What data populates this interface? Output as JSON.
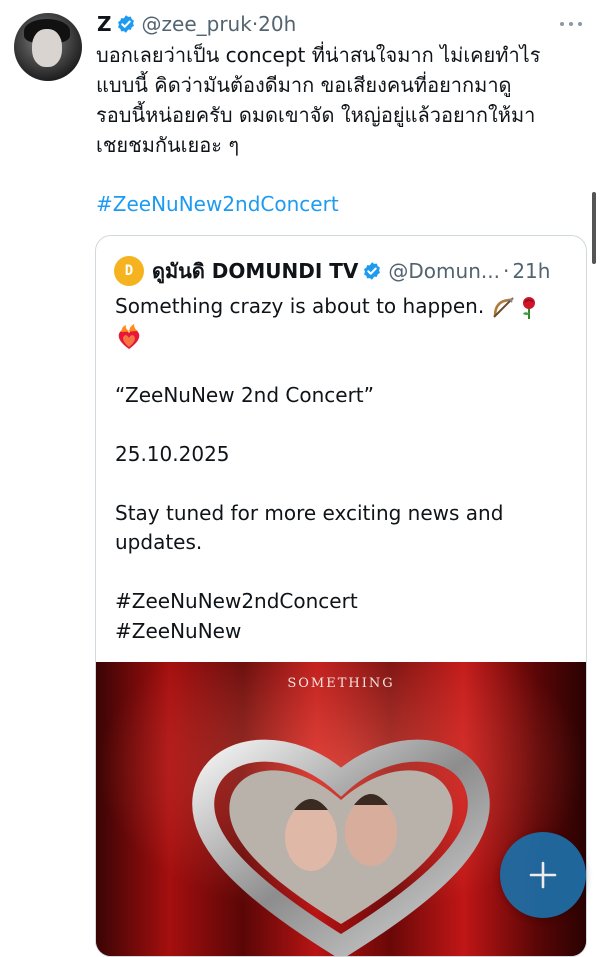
{
  "author": {
    "name": "Z",
    "handle": "@zee_pruk",
    "separator": "·",
    "time": "20h"
  },
  "tweet": {
    "text": "บอกเลยว่าเป็น concept ที่น่าสนใจมาก ไม่เคยทำไร\nแบบนี้ คิดว่ามันต้องดีมาก ขอเสียงคนที่อยากมาดู\nรอบนี้หน่อยครับ ดมดเขาจัด ใหญ่อยู่แล้วอยากให้มา\nเชยชมกันเยอะ ๆ",
    "hashtag": "#ZeeNuNew2ndConcert"
  },
  "quoted": {
    "avatar_text": "D",
    "name": "ดูมันดิ DOMUNDI TV",
    "handle": "@Domun...",
    "separator": "·",
    "time": "21h",
    "line1": "Something crazy is about to happen.",
    "line2": "“ZeeNuNew 2nd Concert”",
    "line3": "25.10.2025",
    "line4": "Stay tuned for more exciting news and\nupdates.",
    "line5": "#ZeeNuNew2ndConcert\n#ZeeNuNew",
    "media_text": "SOMETHING"
  },
  "icons": [
    "verified-badge-icon",
    "more-options-icon",
    "bow-arrow-emoji",
    "rose-emoji",
    "heart-on-fire-emoji",
    "compose-plus-icon"
  ],
  "colors": {
    "link": "#1d9bf0",
    "secondary_text": "#536471",
    "verified": "#1d9bf0",
    "fab": "#1d6fa8",
    "curtain": "#a30f0f"
  }
}
